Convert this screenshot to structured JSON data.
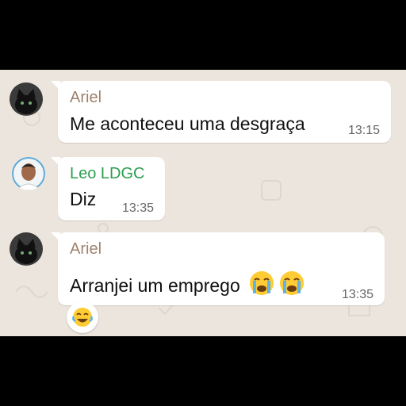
{
  "messages": [
    {
      "sender": "Ariel",
      "text": "Me aconteceu uma desgraça",
      "time": "13:15",
      "avatar_icon": "black-cat-avatar-icon"
    },
    {
      "sender": "Leo LDGC",
      "text": "Diz",
      "time": "13:35",
      "avatar_icon": "person-avatar-icon"
    },
    {
      "sender": "Ariel",
      "text": "Arranjei um emprego",
      "time": "13:35",
      "emojis": [
        "loudly-crying-face-icon",
        "loudly-crying-face-icon"
      ],
      "reaction": "face-with-tears-of-joy-icon"
    }
  ],
  "colors": {
    "chat_background": "#ece5dd",
    "bubble": "#ffffff",
    "ariel_name": "#a0826d",
    "leo_name": "#2e9e4f",
    "time": "#666666"
  }
}
